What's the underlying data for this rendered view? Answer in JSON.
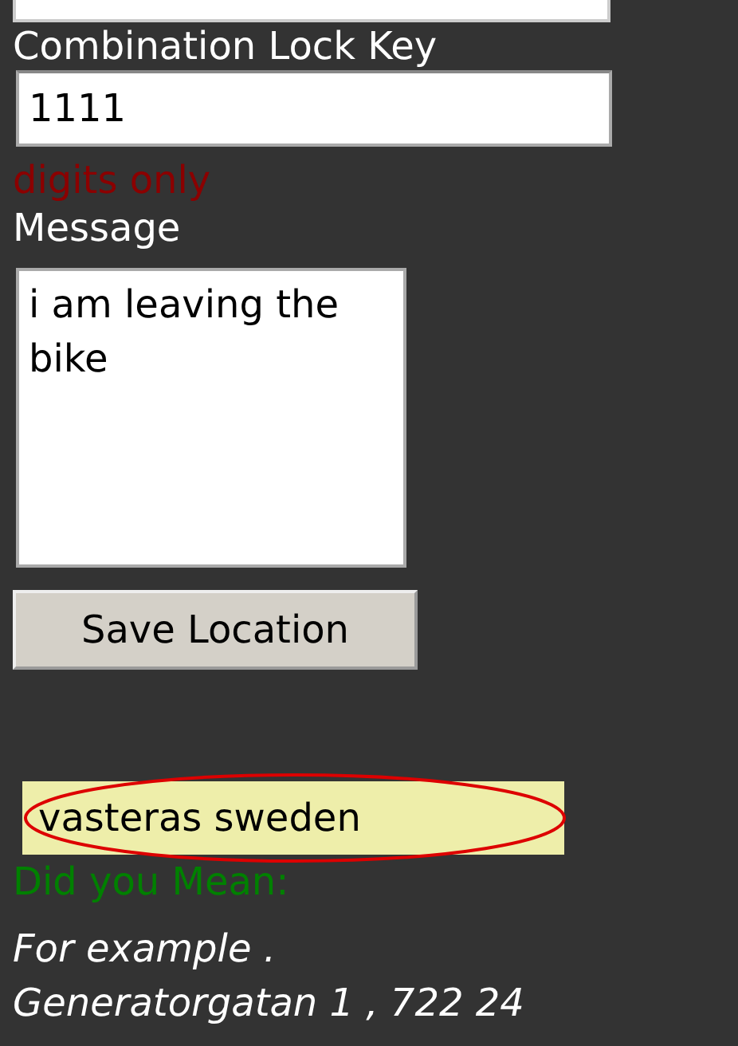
{
  "top_field": {
    "kind": "input"
  },
  "lock_key": {
    "label": "Combination Lock Key",
    "value": "1111",
    "hint": "digits only"
  },
  "message": {
    "label": "Message",
    "value": "i am leaving the bike"
  },
  "save_button": "Save Location",
  "location": {
    "value": "vasteras sweden",
    "circled": true
  },
  "suggestion": "Did you Mean:",
  "example": [
    "For example .",
    "Generatorgatan 1 , 722 24"
  ]
}
